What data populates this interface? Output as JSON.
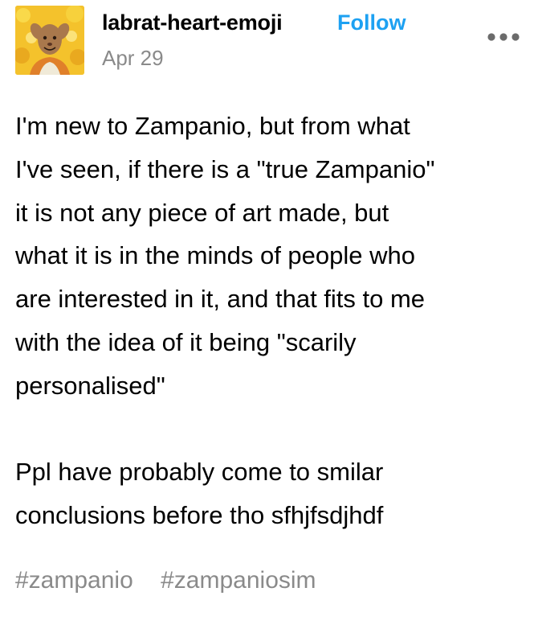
{
  "post": {
    "author": {
      "blog_name": "labrat-heart-emoji",
      "avatar_icon": "avatar-image"
    },
    "follow_label": "Follow",
    "date": "Apr 29",
    "more_icon": "ellipsis-icon",
    "body": {
      "paragraphs": [
        "I'm new to Zampanio, but from what\nI've seen,  if there is a \"true Zampanio\"\nit is not any piece of art made, but\nwhat it is in the minds of people who\nare interested in it, and that fits to me\nwith the idea of it being \"scarily\npersonalised\"",
        "Ppl have probably come to smilar\nconclusions before tho sfhjfsdjhdf"
      ]
    },
    "tags": [
      "#zampanio",
      "#zampaniosim"
    ]
  },
  "colors": {
    "follow": "#1da1f2",
    "muted": "#8a8a8a",
    "text": "#000000",
    "background": "#ffffff"
  }
}
